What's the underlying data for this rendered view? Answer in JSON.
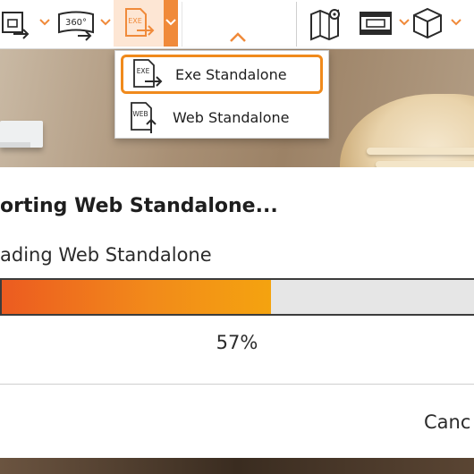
{
  "toolbar": {
    "buttons": [
      {
        "name": "export-image-button",
        "icon": "image-export-icon"
      },
      {
        "name": "export-360-button",
        "icon": "panorama-360-icon",
        "text": "360°"
      },
      {
        "name": "export-standalone-button",
        "icon": "exe-export-icon",
        "text": "EXE"
      },
      {
        "name": "map-button",
        "icon": "map-pin-icon"
      },
      {
        "name": "render-button",
        "icon": "film-strip-icon"
      },
      {
        "name": "object-button",
        "icon": "cube-icon"
      }
    ],
    "accent_color": "#f08a3a"
  },
  "export_menu": {
    "items": [
      {
        "label": "Exe Standalone",
        "icon_text": "EXE",
        "selected": true
      },
      {
        "label": "Web Standalone",
        "icon_text": "WEB",
        "selected": false
      }
    ]
  },
  "dialog": {
    "title": "orting Web Standalone...",
    "status": "ading Web Standalone",
    "progress": 0.57,
    "progress_label": "57%",
    "cancel_label": "Canc"
  },
  "colors": {
    "progress_start": "#ec5b20",
    "progress_end": "#f4a30f",
    "menu_highlight": "#f08a1c"
  }
}
